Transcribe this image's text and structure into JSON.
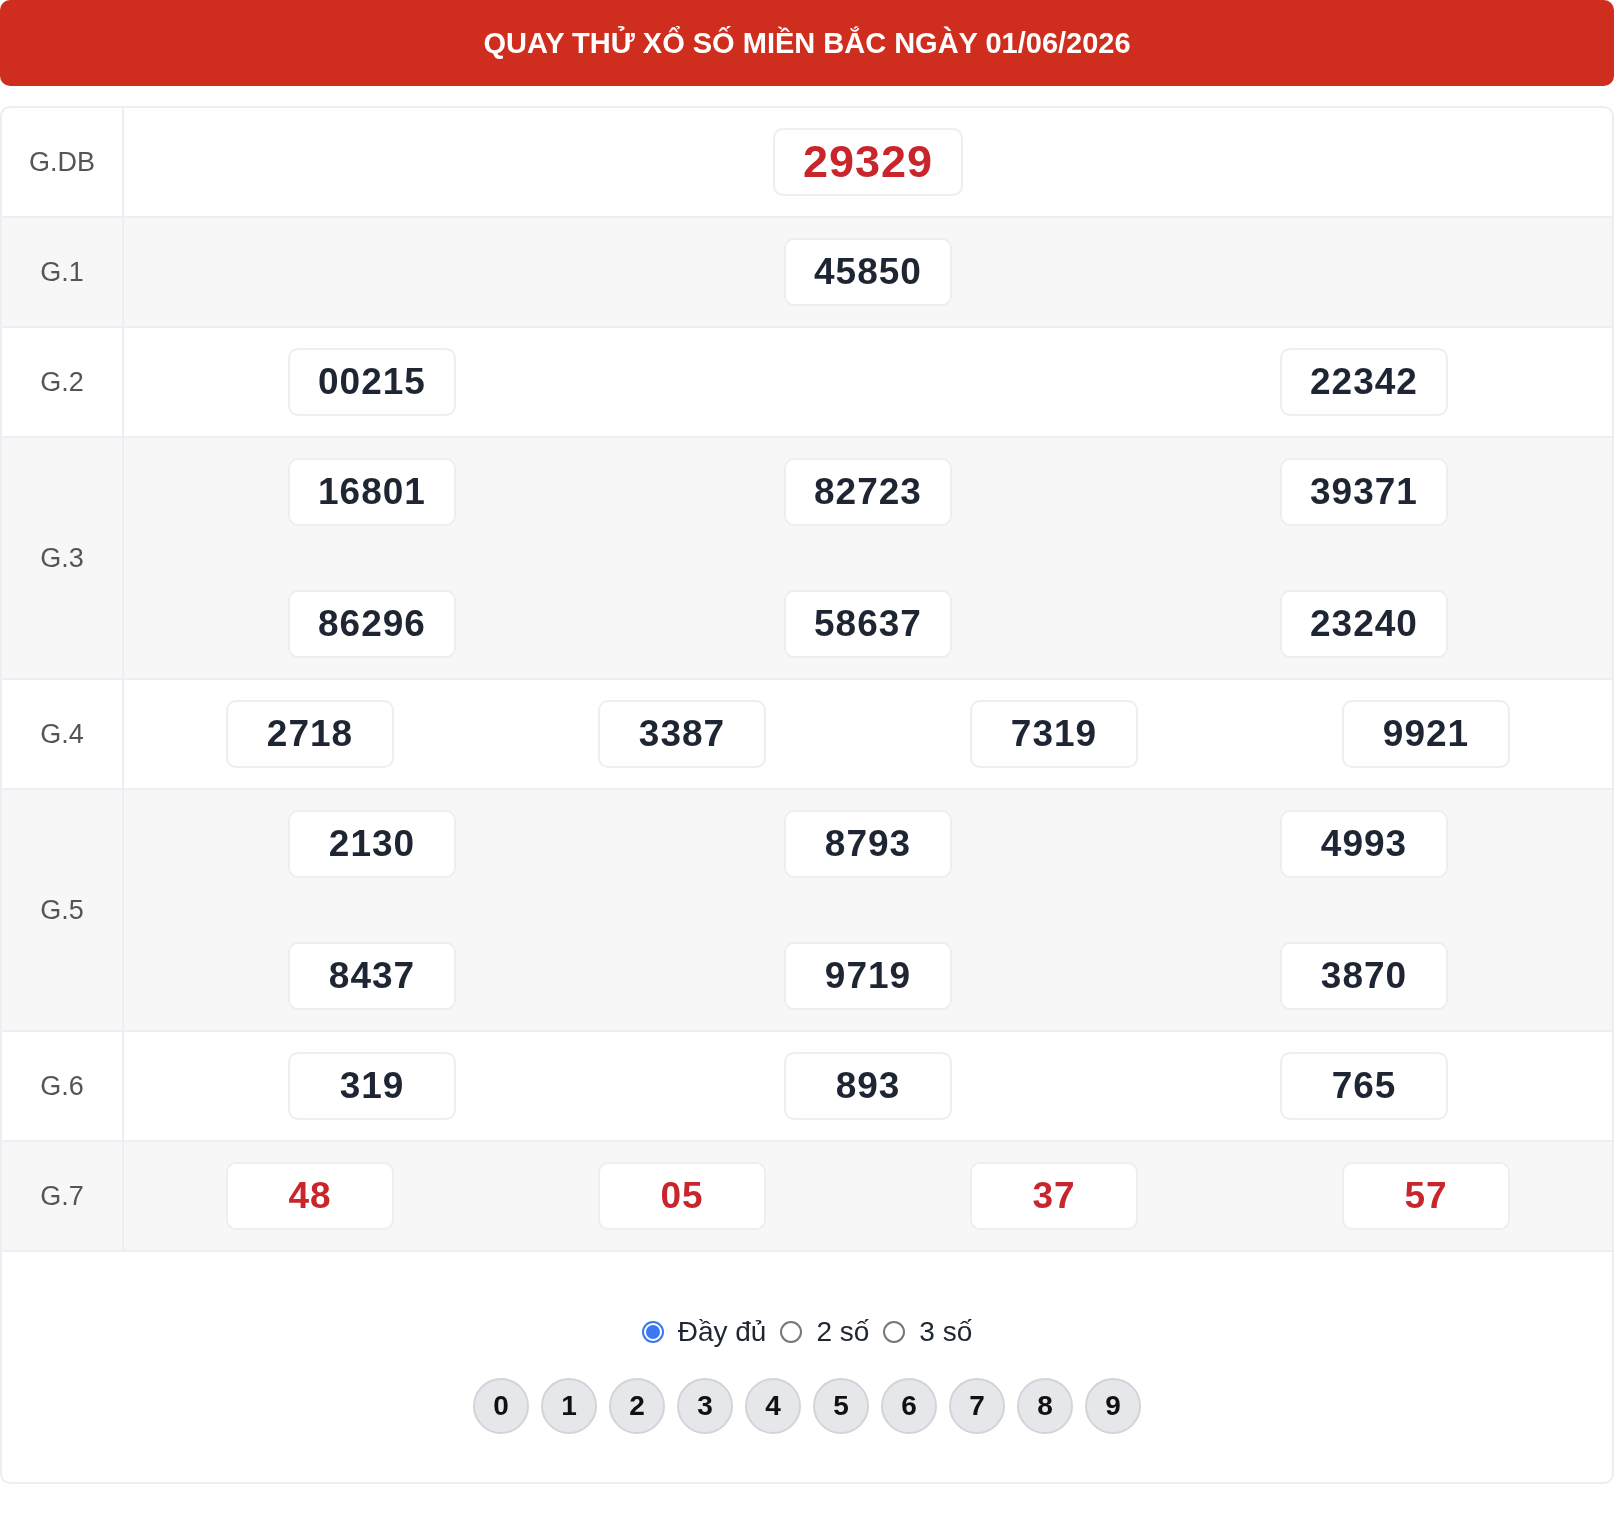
{
  "header": {
    "title": "QUAY THỬ XỔ SỐ MIỀN BẮC NGÀY 01/06/2026"
  },
  "prizes": [
    {
      "label": "G.DB",
      "highlight": true,
      "numbers": [
        "29329"
      ]
    },
    {
      "label": "G.1",
      "highlight": false,
      "numbers": [
        "45850"
      ]
    },
    {
      "label": "G.2",
      "highlight": false,
      "numbers": [
        "00215",
        "22342"
      ]
    },
    {
      "label": "G.3",
      "highlight": false,
      "numbers": [
        "16801",
        "82723",
        "39371",
        "86296",
        "58637",
        "23240"
      ]
    },
    {
      "label": "G.4",
      "highlight": false,
      "numbers": [
        "2718",
        "3387",
        "7319",
        "9921"
      ]
    },
    {
      "label": "G.5",
      "highlight": false,
      "numbers": [
        "2130",
        "8793",
        "4993",
        "8437",
        "9719",
        "3870"
      ]
    },
    {
      "label": "G.6",
      "highlight": false,
      "numbers": [
        "319",
        "893",
        "765"
      ]
    },
    {
      "label": "G.7",
      "highlight": true,
      "numbers": [
        "48",
        "05",
        "37",
        "57"
      ]
    }
  ],
  "display_options": [
    {
      "label": "Đầy đủ",
      "selected": true
    },
    {
      "label": "2 số",
      "selected": false
    },
    {
      "label": "3 số",
      "selected": false
    }
  ],
  "digits": [
    "0",
    "1",
    "2",
    "3",
    "4",
    "5",
    "6",
    "7",
    "8",
    "9"
  ]
}
